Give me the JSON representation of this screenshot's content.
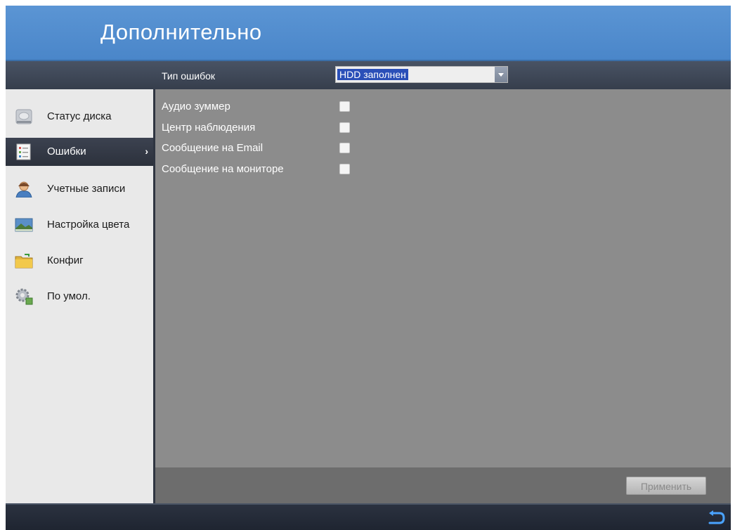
{
  "window": {
    "title": "Дополнительно"
  },
  "sidebar": {
    "items": [
      {
        "label": "Статус диска",
        "icon": "disk-icon",
        "active": false
      },
      {
        "label": "Ошибки",
        "icon": "errors-list-icon",
        "active": true
      },
      {
        "label": "Учетные записи",
        "icon": "user-icon",
        "active": false
      },
      {
        "label": "Настройка цвета",
        "icon": "color-landscape-icon",
        "active": false
      },
      {
        "label": "Конфиг",
        "icon": "folder-icon",
        "active": false
      },
      {
        "label": "По умол.",
        "icon": "gear-icon",
        "active": false
      }
    ]
  },
  "form": {
    "error_type_label": "Тип ошибок",
    "error_type_value": "HDD заполнен",
    "options": [
      {
        "label": "Аудио зуммер",
        "checked": false
      },
      {
        "label": "Центр наблюдения",
        "checked": false
      },
      {
        "label": "Сообщение на Email",
        "checked": false
      },
      {
        "label": "Сообщение на мониторе",
        "checked": false
      }
    ],
    "apply_label": "Применить"
  },
  "colors": {
    "title_bar": "#4a86c9",
    "active_nav": "#2c313c",
    "panel_bg": "#8c8c8c",
    "selection": "#2a4fb8"
  }
}
